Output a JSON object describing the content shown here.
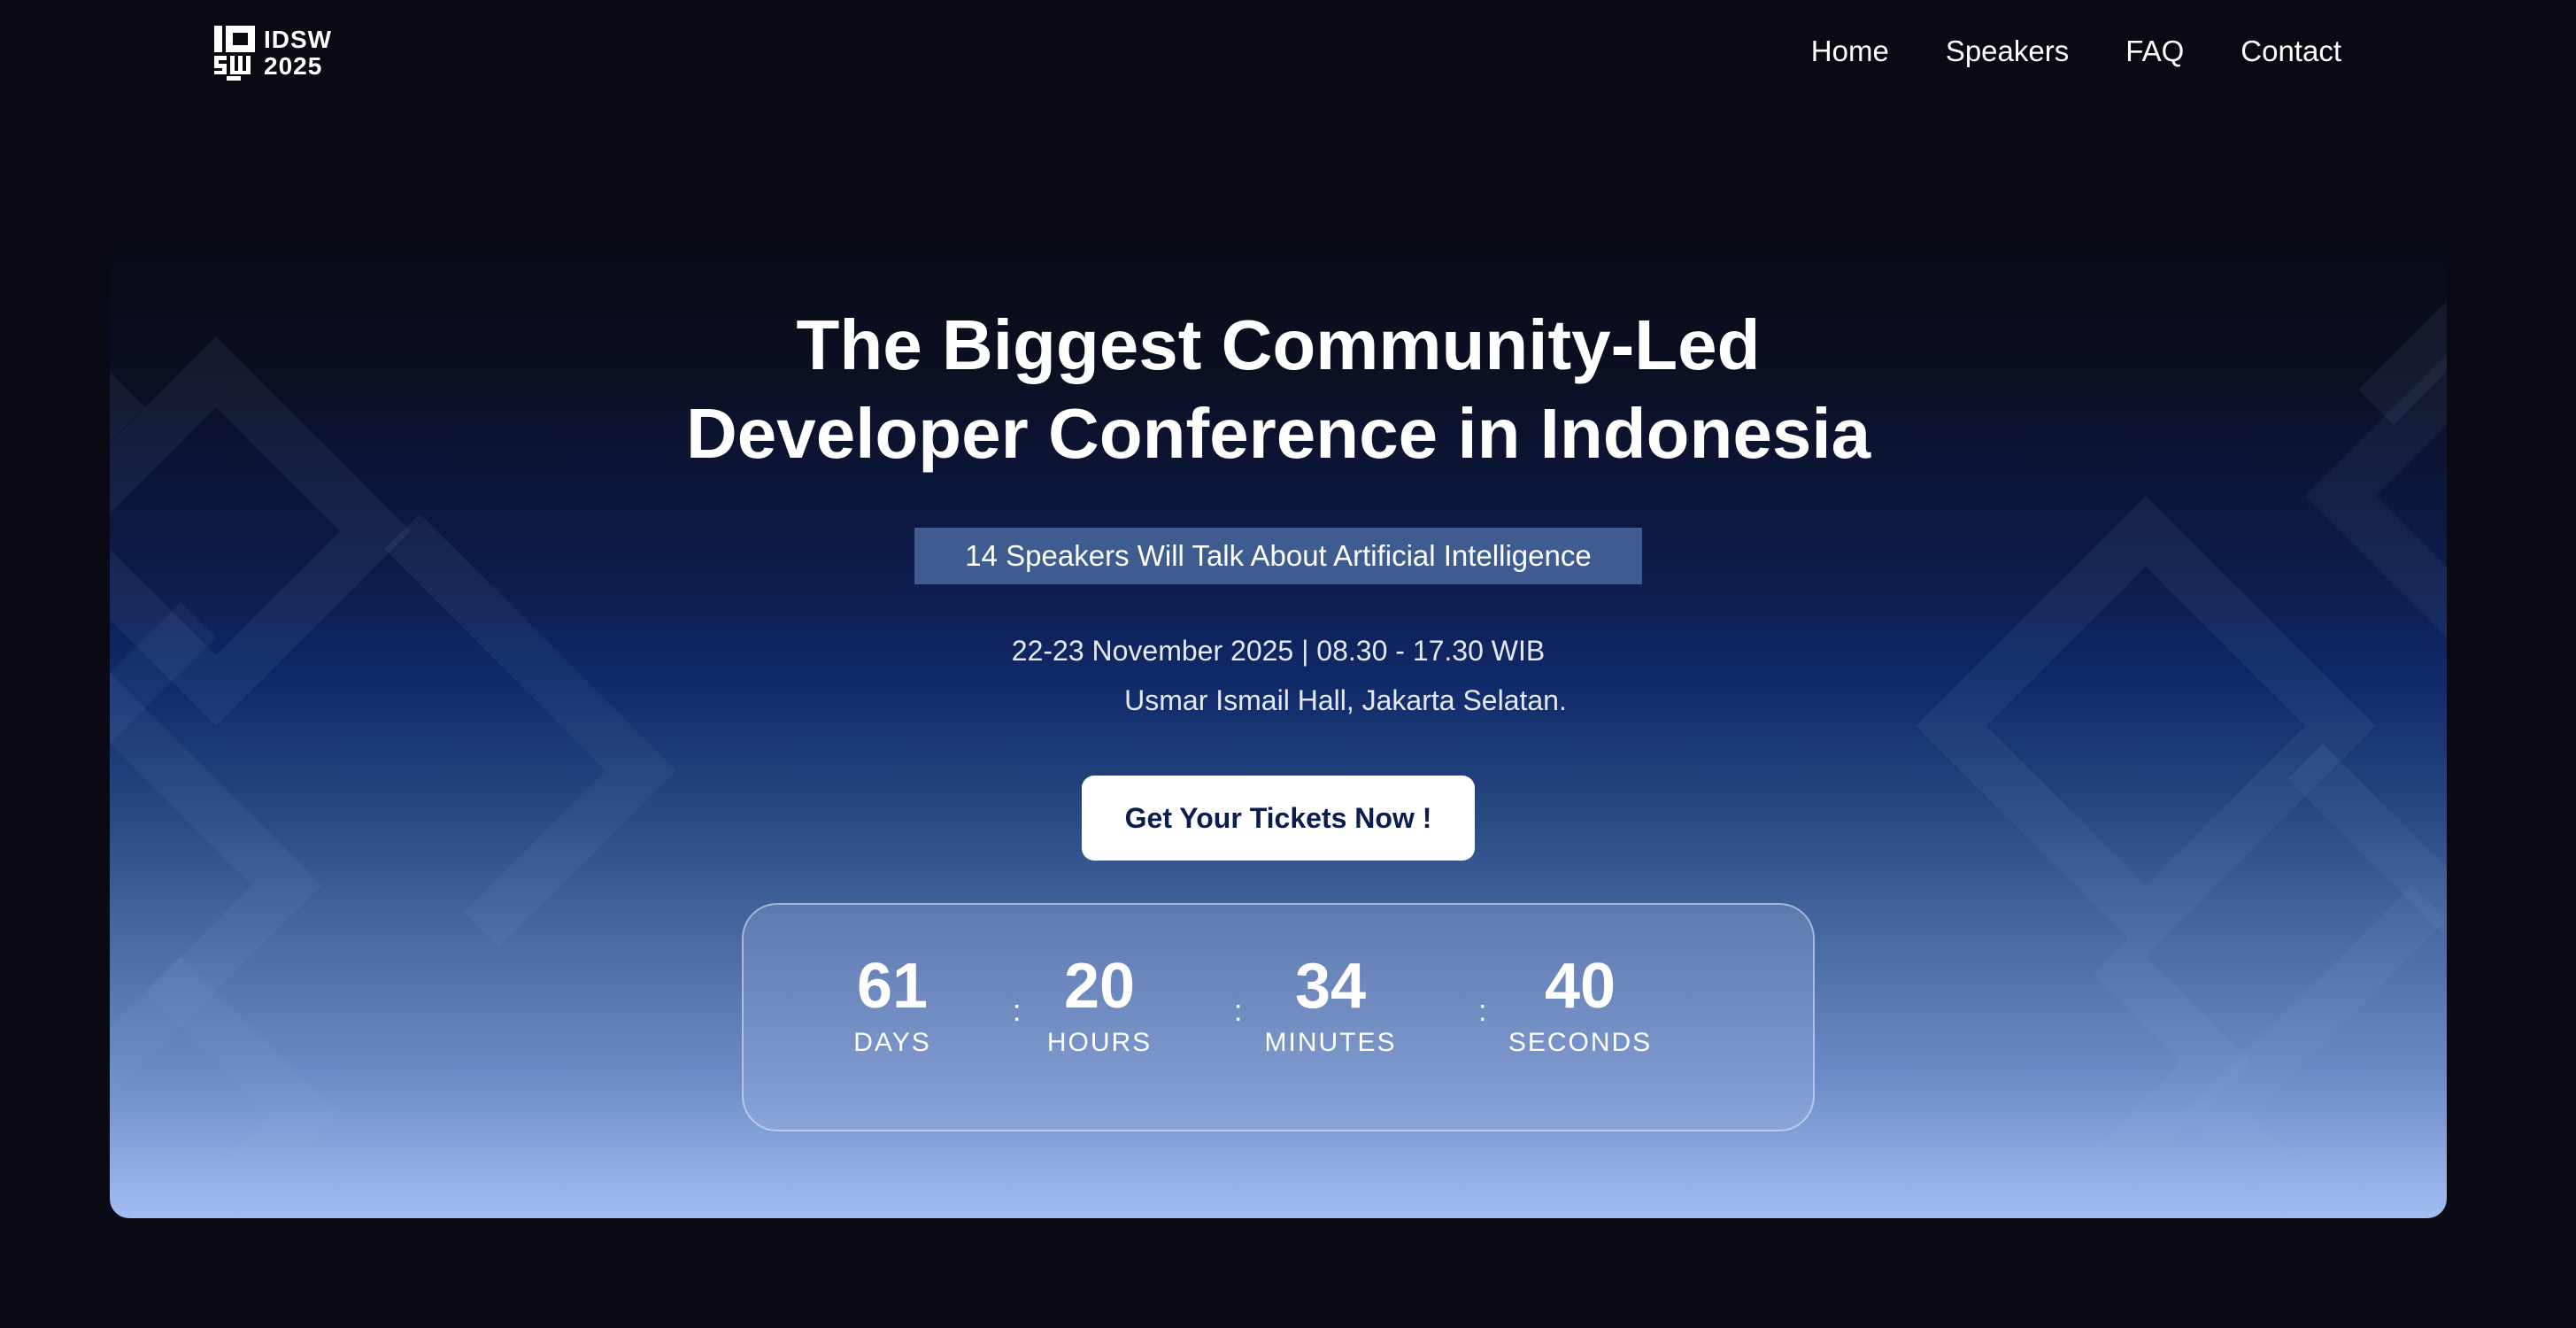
{
  "nav": {
    "logo": {
      "line1": "IDSW",
      "line2": "2025"
    },
    "links": [
      "Home",
      "Speakers",
      "FAQ",
      "Contact"
    ]
  },
  "hero": {
    "title_line1": "The Biggest Community-Led",
    "title_line2": "Developer Conference in Indonesia",
    "tagline": "14 Speakers Will Talk About Artificial Intelligence",
    "date": "22-23 November 2025 | 08.30 - 17.30 WIB",
    "venue": "Usmar Ismail Hall, Jakarta Selatan.",
    "cta_label": "Get Your Tickets Now !"
  },
  "countdown": {
    "separator": ":",
    "days": {
      "value": "61",
      "label": "DAYS"
    },
    "hours": {
      "value": "20",
      "label": "HOURS"
    },
    "minutes": {
      "value": "34",
      "label": "MINUTES"
    },
    "seconds": {
      "value": "40",
      "label": "SECONDS"
    }
  },
  "colors": {
    "page_background": "#090a13",
    "tagline_background": "#3e5c90",
    "cta_text": "#0b1c4f",
    "gradient_bottom": "#a3bdf1"
  }
}
